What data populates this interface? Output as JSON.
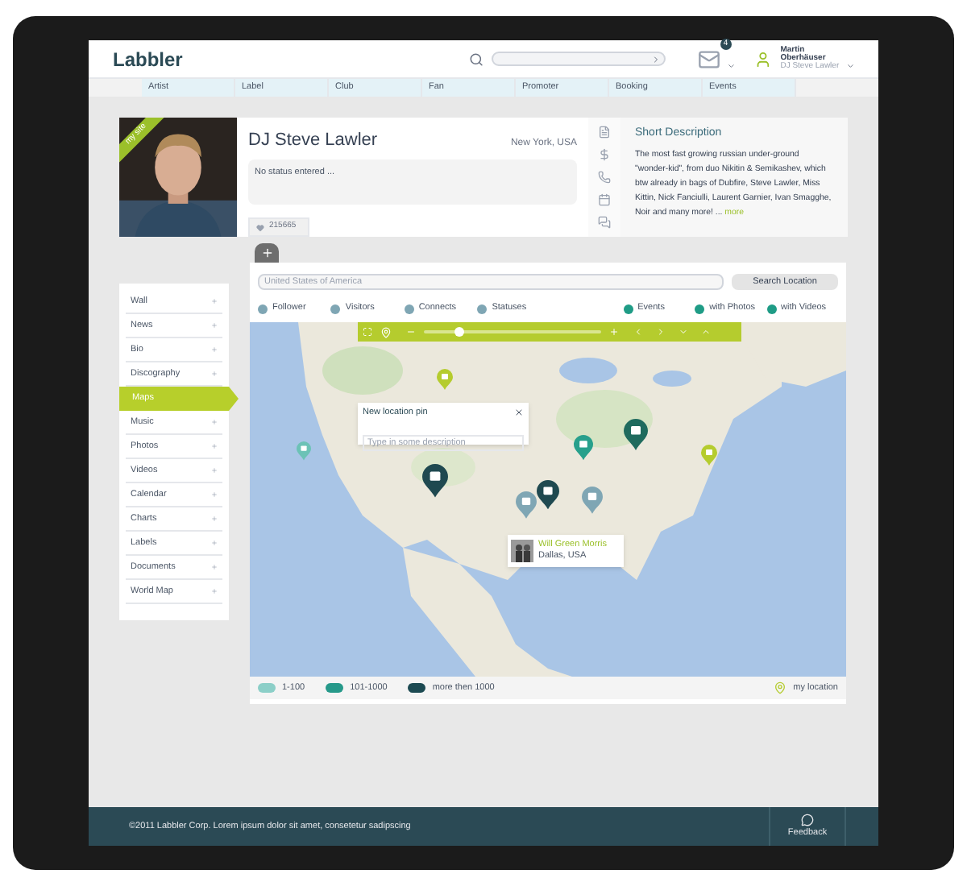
{
  "header": {
    "logo": "Labbler",
    "mail_badge": "4",
    "user": {
      "name": "Martin Oberhäuser",
      "role": "DJ Steve Lawler"
    }
  },
  "nav": [
    {
      "label": "Artist"
    },
    {
      "label": "Label"
    },
    {
      "label": "Club"
    },
    {
      "label": "Fan"
    },
    {
      "label": "Promoter"
    },
    {
      "label": "Booking"
    },
    {
      "label": "Events"
    }
  ],
  "profile": {
    "ribbon": "my site",
    "name": "DJ Steve Lawler",
    "location": "New York, USA",
    "status": "No status entered ...",
    "likes": "215665"
  },
  "description": {
    "title": "Short Description",
    "text": "The most fast growing russian under-ground \"wonder-kid\", from duo Nikitin & Semikashev, which btw already in bags of Dubfire, Steve Lawler, Miss Kittin, Nick Fanciulli, Laurent Garnier, Ivan Smagghe, Noir and many more! ...",
    "more": "more"
  },
  "sidebar": {
    "items": [
      {
        "label": "Wall",
        "selected": false
      },
      {
        "label": "News",
        "selected": false
      },
      {
        "label": "Bio",
        "selected": false
      },
      {
        "label": "Discography",
        "selected": false
      },
      {
        "label": "Maps",
        "selected": true
      },
      {
        "label": "Music",
        "selected": false
      },
      {
        "label": "Photos",
        "selected": false
      },
      {
        "label": "Videos",
        "selected": false
      },
      {
        "label": "Calendar",
        "selected": false
      },
      {
        "label": "Charts",
        "selected": false
      },
      {
        "label": "Labels",
        "selected": false
      },
      {
        "label": "Documents",
        "selected": false
      },
      {
        "label": "World Map",
        "selected": false
      }
    ]
  },
  "map": {
    "search": {
      "placeholder": "United States of America",
      "button": "Search Location"
    },
    "filters": [
      {
        "label": "Follower",
        "color": "#7fa6b4"
      },
      {
        "label": "Visitors",
        "color": "#7fa6b4"
      },
      {
        "label": "Connects",
        "color": "#7fa6b4"
      },
      {
        "label": "Statuses",
        "color": "#7fa6b4"
      },
      {
        "label": "Events",
        "color": "#1f9c86"
      },
      {
        "label": "with Photos",
        "color": "#1f9c86"
      },
      {
        "label": "with Videos",
        "color": "#1f9c86"
      }
    ],
    "zoom": {
      "level": 0.2
    },
    "new_pin_popup": {
      "title": "New location pin",
      "placeholder": "Type in some description"
    },
    "tooltip": {
      "name": "Will Green Morris",
      "place": "Dallas, USA"
    },
    "legend": [
      {
        "label": "1-100",
        "color": "#8ccfc8"
      },
      {
        "label": "101-1000",
        "color": "#26998a"
      },
      {
        "label": "more then 1000",
        "color": "#1c4a52"
      }
    ],
    "my_location": "my location"
  },
  "footer": {
    "copyright": "©2011 Labbler Corp. Lorem ipsum dolor sit amet, consetetur sadipscing",
    "feedback": "Feedback"
  }
}
